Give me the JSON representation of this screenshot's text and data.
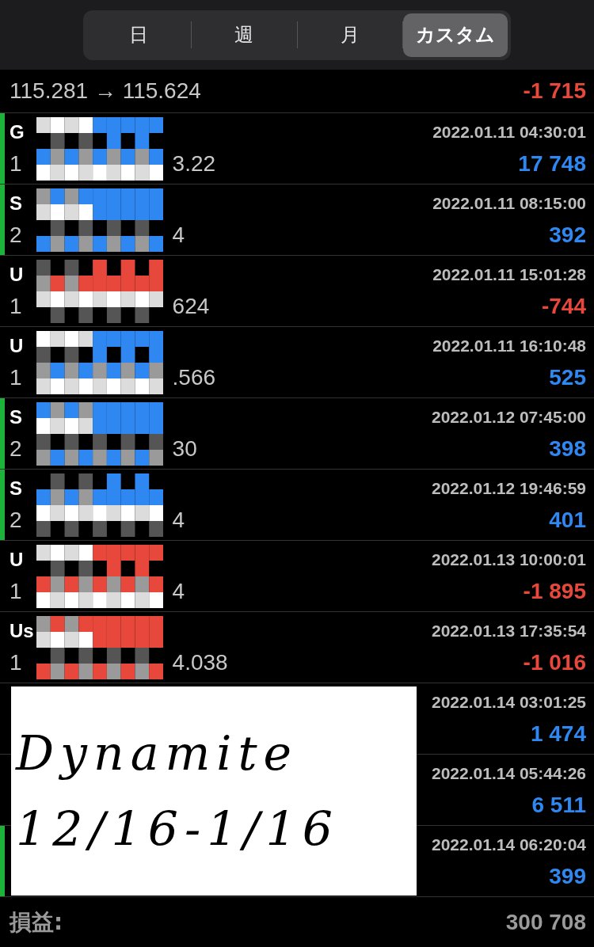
{
  "tabs": [
    {
      "label": "日",
      "selected": false
    },
    {
      "label": "週",
      "selected": false
    },
    {
      "label": "月",
      "selected": false
    },
    {
      "label": "カスタム",
      "selected": true
    }
  ],
  "deals": [
    {
      "price": "115.281 → 115.624",
      "profit": "-1 715",
      "color": "#e8483b",
      "marker": false,
      "redacted": false
    },
    {
      "symbol": "G",
      "price_head": "1",
      "price_tail": "3.22",
      "time": "2022.01.11 04:30:01",
      "profit": "17 748",
      "color": "#2f88f2",
      "marker": true,
      "redacted": true
    },
    {
      "symbol": "S",
      "price_head": "2",
      "price_tail": "4",
      "time": "2022.01.11 08:15:00",
      "profit": "392",
      "color": "#2f88f2",
      "marker": true,
      "redacted": true
    },
    {
      "symbol": "U",
      "price_head": "1",
      "price_tail": "624",
      "time": "2022.01.11 15:01:28",
      "profit": "-744",
      "color": "#e8483b",
      "marker": false,
      "redacted": true
    },
    {
      "symbol": "U",
      "price_head": "1",
      "price_tail": ".566",
      "time": "2022.01.11 16:10:48",
      "profit": "525",
      "color": "#2f88f2",
      "marker": false,
      "redacted": true
    },
    {
      "symbol": "S",
      "price_head": "2",
      "price_tail": "30",
      "time": "2022.01.12 07:45:00",
      "profit": "398",
      "color": "#2f88f2",
      "marker": true,
      "redacted": true
    },
    {
      "symbol": "S",
      "price_head": "2",
      "price_tail": "4",
      "time": "2022.01.12 19:46:59",
      "profit": "401",
      "color": "#2f88f2",
      "marker": true,
      "redacted": true
    },
    {
      "symbol": "U",
      "price_head": "1",
      "price_tail": "4",
      "time": "2022.01.13 10:00:01",
      "profit": "-1 895",
      "color": "#e8483b",
      "marker": false,
      "redacted": true
    },
    {
      "symbol": "Us",
      "price_head": "1",
      "price_tail": "4.038",
      "time": "2022.01.13 17:35:54",
      "profit": "-1 016",
      "color": "#e8483b",
      "marker": false,
      "redacted": true
    },
    {
      "time": "2022.01.14 03:01:25",
      "profit": "1 474",
      "color": "#2f88f2",
      "marker": false,
      "redacted": false
    },
    {
      "time": "2022.01.14 05:44:26",
      "profit": "6 511",
      "color": "#2f88f2",
      "marker": false,
      "redacted": false
    },
    {
      "time": "2022.01.14 06:20:04",
      "profit": "399",
      "color": "#2f88f2",
      "marker": true,
      "redacted": false
    }
  ],
  "overlay_note": [
    "Dynamite",
    "12/16-1/16"
  ],
  "summary": {
    "label": "損益:",
    "value": "300 708"
  }
}
